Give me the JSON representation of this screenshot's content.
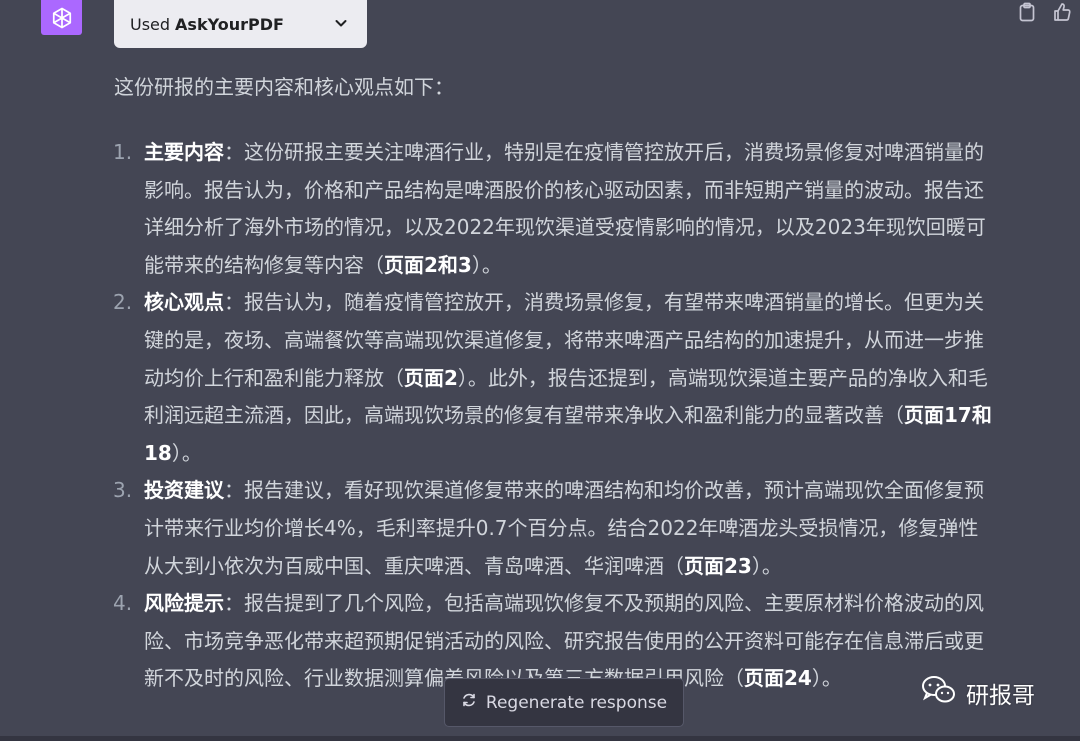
{
  "plugin": {
    "used_label": "Used",
    "name": "AskYourPDF"
  },
  "intro": "这份研报的主要内容和核心观点如下：",
  "items": [
    {
      "num": "1.",
      "title": "主要内容",
      "body": "：这份研报主要关注啤酒行业，特别是在疫情管控放开后，消费场景修复对啤酒销量的影响。报告认为，价格和产品结构是啤酒股价的核心驱动因素，而非短期产销量的波动。报告还详细分析了海外市场的情况，以及2022年现饮渠道受疫情影响的情况，以及2023年现饮回暖可能带来的结构修复等内容（",
      "ref": "页面2和3",
      "end": "）。"
    },
    {
      "num": "2.",
      "title": "核心观点",
      "body": "：报告认为，随着疫情管控放开，消费场景修复，有望带来啤酒销量的增长。但更为关键的是，夜场、高端餐饮等高端现饮渠道修复，将带来啤酒产品结构的加速提升，从而进一步推动均价上行和盈利能力释放（",
      "ref": "页面2",
      "mid": "）。此外，报告还提到，高端现饮渠道主要产品的净收入和毛利润远超主流酒，因此，高端现饮场景的修复有望带来净收入和盈利能力的显著改善（",
      "ref2": "页面17和18",
      "end": "）。"
    },
    {
      "num": "3.",
      "title": "投资建议",
      "body": "：报告建议，看好现饮渠道修复带来的啤酒结构和均价改善，预计高端现饮全面修复预计带来行业均价增长4%，毛利率提升0.7个百分点。结合2022年啤酒龙头受损情况，修复弹性从大到小依次为百威中国、重庆啤酒、青岛啤酒、华润啤酒（",
      "ref": "页面23",
      "end": "）。"
    },
    {
      "num": "4.",
      "title": "风险提示",
      "body": "：报告提到了几个风险，包括高端现饮修复不及预期的风险、主要原材料价格波动的风险、市场竞争恶化带来超预期促销活动的风险、研究报告使用的公开资料可能存在信息滞后或更新不及时的风险、行业数据测算偏差风险以及第三方数据引用风险（",
      "ref": "页面24",
      "end": "）。"
    }
  ],
  "regenerate_label": "Regenerate response",
  "watermark": "研报哥",
  "icons": {
    "avatar": "openai-logo-icon",
    "chevron": "chevron-down-icon",
    "copy": "clipboard-icon",
    "thumbs_up": "thumbs-up-icon",
    "regenerate": "refresh-icon",
    "wechat": "wechat-icon"
  },
  "colors": {
    "background": "#444654",
    "avatar": "#ab68ff",
    "pill": "#ececf1",
    "text": "#d1d5db"
  }
}
